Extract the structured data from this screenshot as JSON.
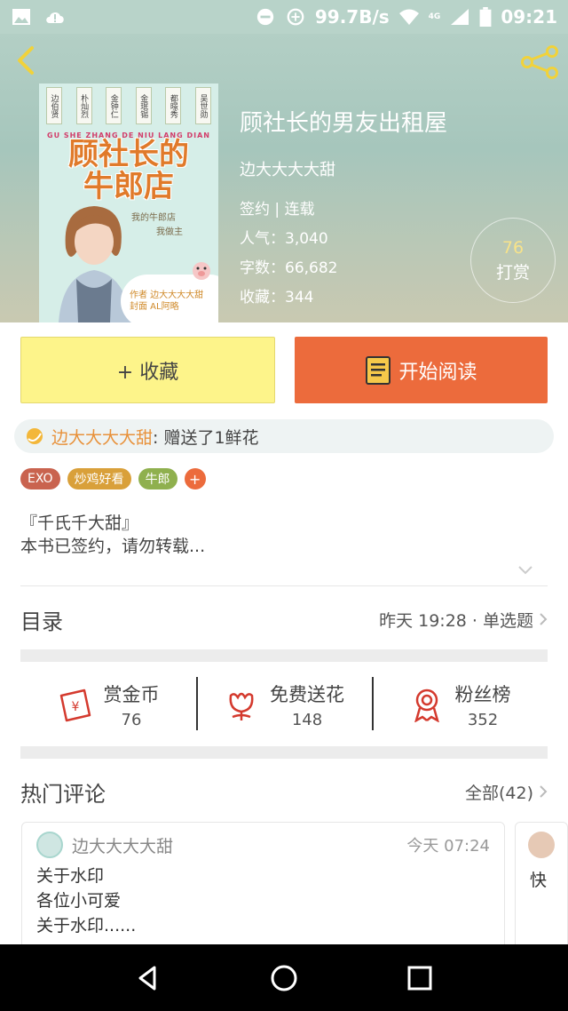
{
  "status_bar": {
    "net_speed": "99.7B/s",
    "network": "4G",
    "time": "09:21",
    "icons": [
      "image-icon",
      "cloud-alert-icon",
      "dnd-icon",
      "data-saver-icon",
      "wifi-icon",
      "signal-icon",
      "battery-icon"
    ]
  },
  "book": {
    "title": "顾社长的男友出租屋",
    "author": "边大大大大甜",
    "status": "签约 | 连载",
    "popularity": "人气：3,040",
    "words": "字数：66,682",
    "favorites": "收藏：344"
  },
  "cover": {
    "vertical_tags": [
      "边伯贤",
      "朴灿烈",
      "金钟仁",
      "金珉锡",
      "都暻秀",
      "吴世勋"
    ],
    "pinyin": "GU SHE ZHANG DE NIU LANG DIAN",
    "title": "顾社长的牛郎店",
    "subtitle_1": "我的牛郎店",
    "subtitle_2": "我做主",
    "author_line": "作者 边大大大大甜",
    "design_line": "封面 AL阿略"
  },
  "tip": {
    "count": "76",
    "label": "打赏"
  },
  "actions": {
    "collect_label": "+ 收藏",
    "read_label": "开始阅读"
  },
  "gift": {
    "name": "边大大大大甜",
    "text": ": 赠送了1鲜花"
  },
  "tags": [
    {
      "label": "EXO",
      "color": "#c9634f"
    },
    {
      "label": "炒鸡好看",
      "color": "#d9a03a"
    },
    {
      "label": "牛郎",
      "color": "#8fb04e"
    }
  ],
  "description": {
    "line1": "『千氏千大甜』",
    "line2": "本书已签约，请勿转载..."
  },
  "toc": {
    "label": "目录",
    "latest": "昨天 19:28 · 单选题"
  },
  "stats": [
    {
      "label": "赏金币",
      "value": "76",
      "icon": "coin-envelope-icon"
    },
    {
      "label": "免费送花",
      "value": "148",
      "icon": "flower-icon"
    },
    {
      "label": "粉丝榜",
      "value": "352",
      "icon": "award-badge-icon"
    }
  ],
  "hot_comments": {
    "label": "热门评论",
    "all": "全部(42)"
  },
  "comments": [
    {
      "user": "边大大大大甜",
      "time": "今天 07:24",
      "lines": [
        "关于水印",
        "各位小可爱",
        "关于水印......"
      ]
    },
    {
      "preview": "快"
    }
  ],
  "colors": {
    "accent_orange": "#ec6b3c",
    "collect_yellow": "#fdf48a",
    "gift_name": "#e8913a"
  }
}
